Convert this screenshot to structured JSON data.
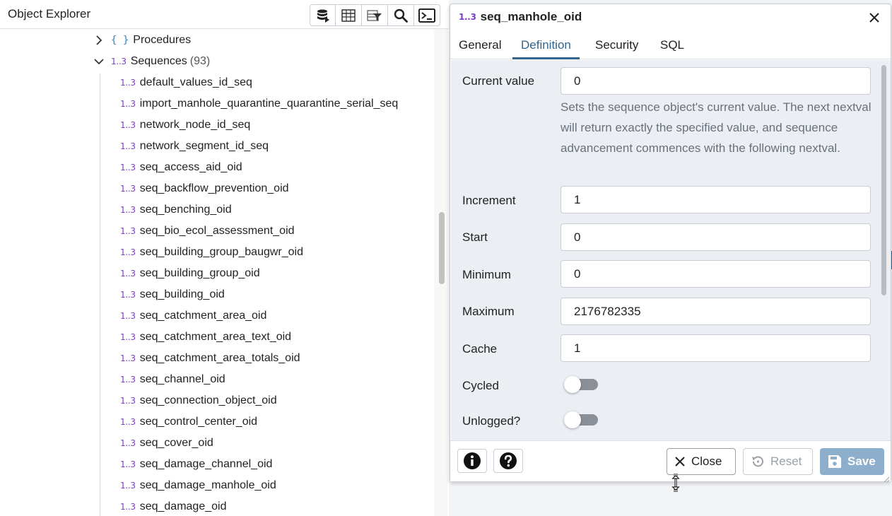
{
  "explorer": {
    "title": "Object Explorer",
    "toolbar": [
      "database-query-icon",
      "table-view-icon",
      "filter-rows-icon",
      "search-icon",
      "terminal-icon"
    ],
    "procedures_label": "Procedures",
    "sequences_label": "Sequences",
    "sequences_count": "(93)",
    "sequence_icon_text": "1..3",
    "procedure_icon_text": "{ }",
    "sequences": [
      "default_values_id_seq",
      "import_manhole_quarantine_quarantine_serial_seq",
      "network_node_id_seq",
      "network_segment_id_seq",
      "seq_access_aid_oid",
      "seq_backflow_prevention_oid",
      "seq_benching_oid",
      "seq_bio_ecol_assessment_oid",
      "seq_building_group_baugwr_oid",
      "seq_building_group_oid",
      "seq_building_oid",
      "seq_catchment_area_oid",
      "seq_catchment_area_text_oid",
      "seq_catchment_area_totals_oid",
      "seq_channel_oid",
      "seq_connection_object_oid",
      "seq_control_center_oid",
      "seq_cover_oid",
      "seq_damage_channel_oid",
      "seq_damage_manhole_oid",
      "seq_damage_oid"
    ]
  },
  "dialog": {
    "icon_text": "1..3",
    "title": "seq_manhole_oid",
    "tabs": [
      "General",
      "Definition",
      "Security",
      "SQL"
    ],
    "active_tab": "Definition",
    "fields": {
      "current_value": {
        "label": "Current value",
        "value": "0",
        "help": "Sets the sequence object's current value. The next nextval will return exactly the specified value, and sequence advancement commences with the following nextval."
      },
      "increment": {
        "label": "Increment",
        "value": "1"
      },
      "start": {
        "label": "Start",
        "value": "0"
      },
      "minimum": {
        "label": "Minimum",
        "value": "0"
      },
      "maximum": {
        "label": "Maximum",
        "value": "2176782335"
      },
      "cache": {
        "label": "Cache",
        "value": "1"
      },
      "cycled": {
        "label": "Cycled",
        "on": false
      },
      "unlogged": {
        "label": "Unlogged?",
        "on": false
      }
    },
    "footer": {
      "close_label": "Close",
      "reset_label": "Reset",
      "save_label": "Save"
    }
  },
  "colors": {
    "accent": "#326690",
    "sequence_icon": "#7a3ec6",
    "procedure_icon": "#2c86c9",
    "save_button": "#8eafcc",
    "panel_bg": "#ebeef3"
  }
}
